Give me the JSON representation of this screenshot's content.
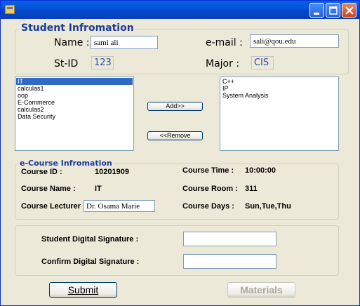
{
  "student": {
    "title": "Student Infromation",
    "name_label": "Name :",
    "name_value": "sami ali",
    "email_label": "e-mail :",
    "email_value": "sali@qou.edu",
    "stid_label": "St-ID",
    "stid_value": "123",
    "major_label": "Major :",
    "major_value": "CIS"
  },
  "available_courses": [
    "IT",
    "calculas1",
    "oop",
    "E-Commerce",
    "calculas2",
    "Data Security"
  ],
  "selected_available": "IT",
  "chosen_courses": [
    "C++",
    "IP",
    "System Analysis"
  ],
  "buttons": {
    "add": "Add>>",
    "remove": "<<Remove",
    "submit": "Submit",
    "materials": "Materials"
  },
  "course": {
    "title": "e-Course Infromation",
    "id_label": "Course ID :",
    "id_value": "10201909",
    "time_label": "Course Time :",
    "time_value": "10:00:00",
    "name_label": "Course Name :",
    "name_value": "IT",
    "room_label": "Course Room :",
    "room_value": "311",
    "lecturer_label": "Course Lecturer :",
    "lecturer_value": "Dr. Osama Marie",
    "days_label": "Course Days :",
    "days_value": "Sun,Tue,Thu"
  },
  "signature": {
    "student_label": "Student Digital Signature :",
    "student_value": "",
    "confirm_label": "Confirm  Digital Signature :",
    "confirm_value": ""
  },
  "colors": {
    "titlebar": "#0550d8",
    "heading": "#1b3aa0",
    "selection": "#316ac5"
  }
}
